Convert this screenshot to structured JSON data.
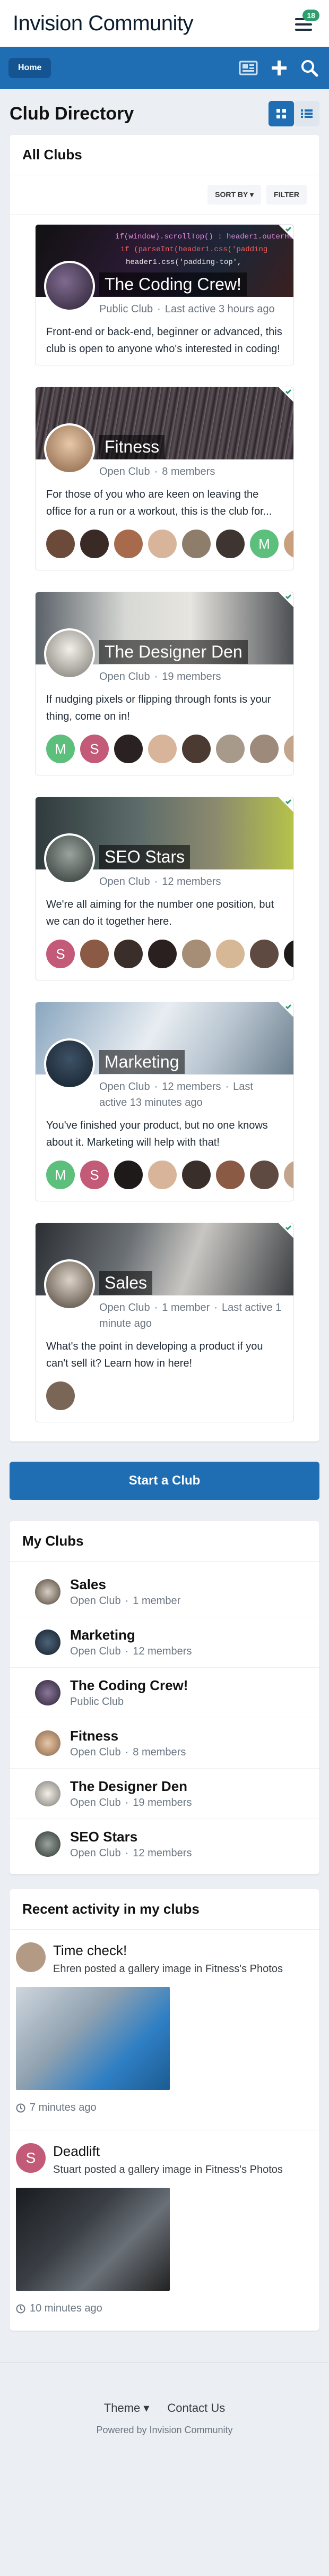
{
  "app": {
    "title": "Invision Community",
    "notification_count": "18"
  },
  "nav": {
    "home_label": "Home"
  },
  "page": {
    "title": "Club Directory"
  },
  "all_clubs": {
    "title": "All Clubs",
    "sort_label": "SORT BY ▾",
    "filter_label": "FILTER",
    "clubs": [
      {
        "name": "The Coding Crew!",
        "type": "Public Club",
        "extra": "Last active 3 hours ago",
        "members": "",
        "desc": "Front-end or back-end, beginner or advanced, this club is open to anyone who's interested in coding!"
      },
      {
        "name": "Fitness",
        "type": "Open Club",
        "members": "8 members",
        "extra": "",
        "desc": "For those of you who are keen on leaving the office for a run or a workout, this is the club for..."
      },
      {
        "name": "The Designer Den",
        "type": "Open Club",
        "members": "19 members",
        "extra": "",
        "desc": "If nudging pixels or flipping through fonts is your thing, come on in!"
      },
      {
        "name": "SEO Stars",
        "type": "Open Club",
        "members": "12 members",
        "extra": "",
        "desc": "We're all aiming for the number one position, but we can do it together here."
      },
      {
        "name": "Marketing",
        "type": "Open Club",
        "members": "12 members",
        "extra": "Last active 13 minutes ago",
        "desc": "You've finished your product, but no one knows about it. Marketing will help with that!"
      },
      {
        "name": "Sales",
        "type": "Open Club",
        "members": "1 member",
        "extra": "Last active 1 minute ago",
        "desc": "What's the point in developing a product if you can't sell it? Learn how in here!"
      }
    ]
  },
  "start_club_label": "Start a Club",
  "my_clubs": {
    "title": "My Clubs",
    "items": [
      {
        "name": "Sales",
        "type": "Open Club",
        "members": "1 member"
      },
      {
        "name": "Marketing",
        "type": "Open Club",
        "members": "12 members"
      },
      {
        "name": "The Coding Crew!",
        "type": "Public Club",
        "members": ""
      },
      {
        "name": "Fitness",
        "type": "Open Club",
        "members": "8 members"
      },
      {
        "name": "The Designer Den",
        "type": "Open Club",
        "members": "19 members"
      },
      {
        "name": "SEO Stars",
        "type": "Open Club",
        "members": "12 members"
      }
    ]
  },
  "activity": {
    "title": "Recent activity in my clubs",
    "items": [
      {
        "title": "Time check!",
        "sub": "Ehren posted a gallery image in Fitness's Photos",
        "time": "7 minutes ago",
        "initial": ""
      },
      {
        "title": "Deadlift",
        "sub": "Stuart posted a gallery image in Fitness's Photos",
        "time": "10 minutes ago",
        "initial": "S"
      }
    ]
  },
  "member_initials": {
    "m": "M",
    "s": "S"
  },
  "footer": {
    "theme_label": "Theme ▾",
    "contact_label": "Contact Us",
    "powered": "Powered by Invision Community"
  },
  "colors": {
    "brand": "#1f6db3",
    "accent_green": "#2f9e6e",
    "bg": "#ebeef2"
  }
}
